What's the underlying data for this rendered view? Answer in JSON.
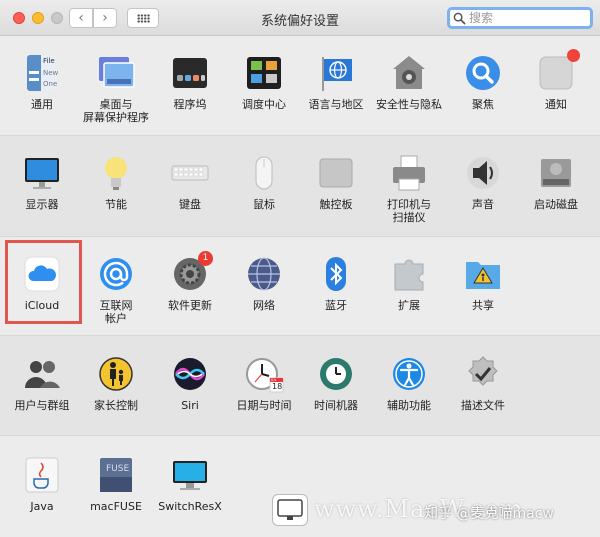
{
  "window": {
    "title": "系统偏好设置"
  },
  "toolbar": {
    "back": "‹",
    "forward": "›"
  },
  "search": {
    "placeholder": "搜索"
  },
  "rows": [
    {
      "items": [
        {
          "id": "general",
          "label": "通用",
          "icon": "general-icon"
        },
        {
          "id": "desktop",
          "label": "桌面与\n屏幕保护程序",
          "icon": "desktop-screensaver-icon"
        },
        {
          "id": "dock",
          "label": "程序坞",
          "icon": "dock-icon"
        },
        {
          "id": "mission",
          "label": "调度中心",
          "icon": "mission-control-icon"
        },
        {
          "id": "language",
          "label": "语言与地区",
          "icon": "language-region-icon"
        },
        {
          "id": "security",
          "label": "安全性与隐私",
          "icon": "security-privacy-icon"
        },
        {
          "id": "spotlight",
          "label": "聚焦",
          "icon": "spotlight-icon"
        },
        {
          "id": "notifications",
          "label": "通知",
          "icon": "notifications-icon"
        }
      ]
    },
    {
      "items": [
        {
          "id": "displays",
          "label": "显示器",
          "icon": "display-icon"
        },
        {
          "id": "energy",
          "label": "节能",
          "icon": "energy-saver-icon"
        },
        {
          "id": "keyboard",
          "label": "键盘",
          "icon": "keyboard-icon"
        },
        {
          "id": "mouse",
          "label": "鼠标",
          "icon": "mouse-icon"
        },
        {
          "id": "trackpad",
          "label": "触控板",
          "icon": "trackpad-icon"
        },
        {
          "id": "printers",
          "label": "打印机与\n扫描仪",
          "icon": "printer-icon"
        },
        {
          "id": "sound",
          "label": "声音",
          "icon": "sound-icon"
        },
        {
          "id": "startup",
          "label": "启动磁盘",
          "icon": "startup-disk-icon"
        }
      ]
    },
    {
      "items": [
        {
          "id": "icloud",
          "label": "iCloud",
          "icon": "icloud-icon"
        },
        {
          "id": "internet",
          "label": "互联网\n帐户",
          "icon": "internet-accounts-icon"
        },
        {
          "id": "swupdate",
          "label": "软件更新",
          "icon": "software-update-icon",
          "badge": "1"
        },
        {
          "id": "network",
          "label": "网络",
          "icon": "network-icon"
        },
        {
          "id": "bluetooth",
          "label": "蓝牙",
          "icon": "bluetooth-icon"
        },
        {
          "id": "extensions",
          "label": "扩展",
          "icon": "extensions-icon"
        },
        {
          "id": "sharing",
          "label": "共享",
          "icon": "sharing-icon"
        }
      ]
    },
    {
      "items": [
        {
          "id": "users",
          "label": "用户与群组",
          "icon": "users-groups-icon"
        },
        {
          "id": "parental",
          "label": "家长控制",
          "icon": "parental-controls-icon"
        },
        {
          "id": "siri",
          "label": "Siri",
          "icon": "siri-icon"
        },
        {
          "id": "datetime",
          "label": "日期与时间",
          "icon": "date-time-icon"
        },
        {
          "id": "timemachine",
          "label": "时间机器",
          "icon": "time-machine-icon"
        },
        {
          "id": "accessibility",
          "label": "辅助功能",
          "icon": "accessibility-icon"
        },
        {
          "id": "profiles",
          "label": "描述文件",
          "icon": "profiles-icon"
        }
      ]
    },
    {
      "items": [
        {
          "id": "java",
          "label": "Java",
          "icon": "java-icon"
        },
        {
          "id": "macfuse",
          "label": "macFUSE",
          "icon": "macfuse-icon"
        },
        {
          "id": "switchresx",
          "label": "SwitchResX",
          "icon": "switchresx-icon"
        }
      ]
    }
  ],
  "icon_text": {
    "general_file": "File",
    "general_new": "New",
    "general_one": "One",
    "macfuse": "FUSE",
    "calendar_month": "JUL",
    "calendar_day": "18"
  },
  "watermark": {
    "site": "www.MacW.com",
    "credit": "知乎 @麦克喵macw"
  },
  "colors": {
    "highlight": "#e0574f",
    "accent_blue": "#1e88e5",
    "badge": "#ed3b33"
  }
}
